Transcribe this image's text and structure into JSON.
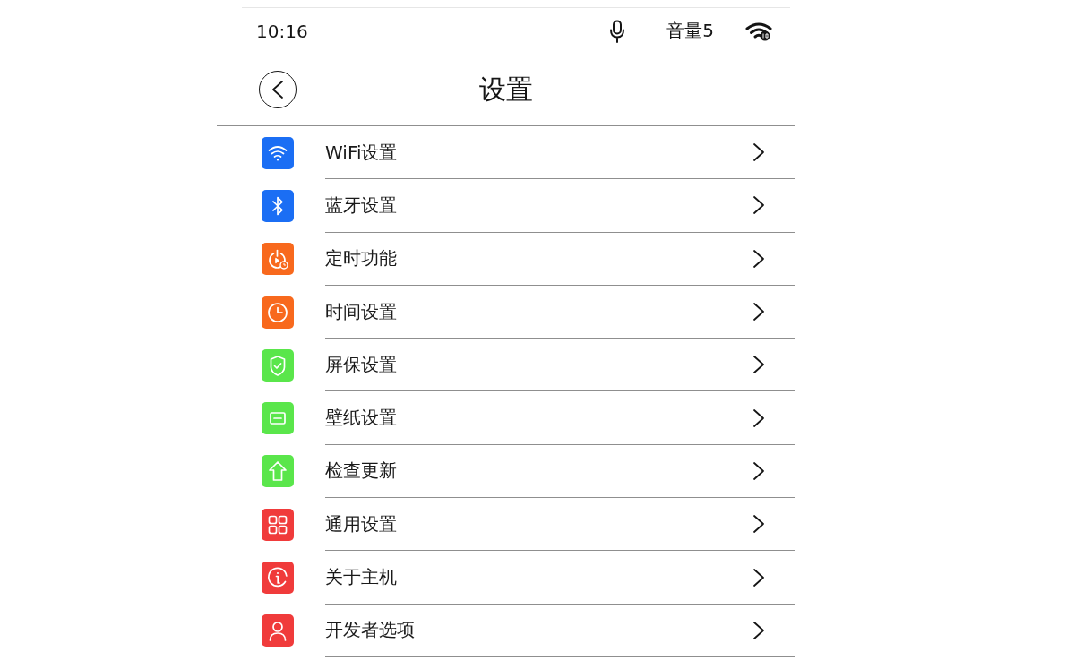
{
  "status_bar": {
    "time": "10:16",
    "volume": "音量5"
  },
  "header": {
    "title": "设置"
  },
  "items": [
    {
      "label": "WiFi设置",
      "color": "#1b6ef4"
    },
    {
      "label": "蓝牙设置",
      "color": "#1b6ef4"
    },
    {
      "label": "定时功能",
      "color": "#f8691d"
    },
    {
      "label": "时间设置",
      "color": "#f8691d"
    },
    {
      "label": "屏保设置",
      "color": "#5ae64b"
    },
    {
      "label": "壁纸设置",
      "color": "#5ae64b"
    },
    {
      "label": "检查更新",
      "color": "#5ae64b"
    },
    {
      "label": "通用设置",
      "color": "#f03b3b"
    },
    {
      "label": "关于主机",
      "color": "#f03b3b"
    },
    {
      "label": "开发者选项",
      "color": "#f03b3b"
    }
  ]
}
